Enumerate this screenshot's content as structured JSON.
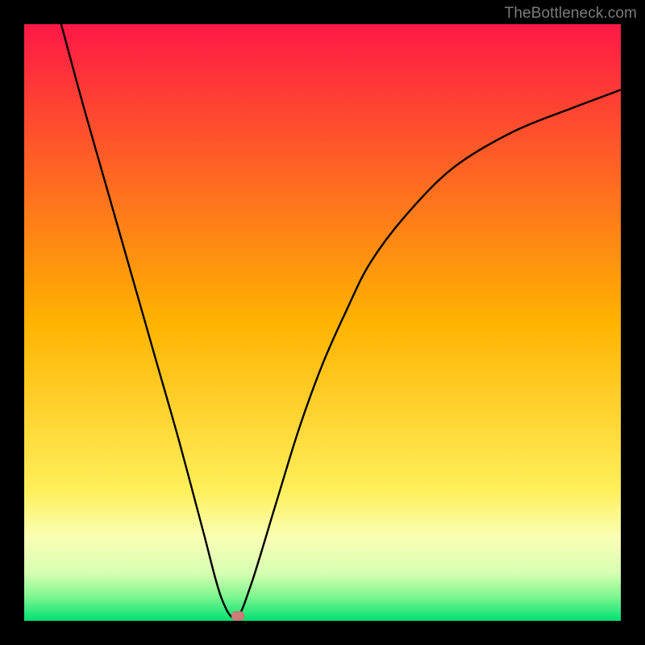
{
  "watermark": {
    "text": "TheBottleneck.com"
  },
  "chart_data": {
    "type": "line",
    "title": "",
    "xlabel": "",
    "ylabel": "",
    "xlim": [
      0,
      1
    ],
    "ylim": [
      0,
      1
    ],
    "gradient_stops": [
      {
        "offset": 0.0,
        "color": "#ff1846"
      },
      {
        "offset": 0.5,
        "color": "#ffb300"
      },
      {
        "offset": 0.78,
        "color": "#ffef5a"
      },
      {
        "offset": 0.86,
        "color": "#f9ffb4"
      },
      {
        "offset": 0.92,
        "color": "#d7ffb3"
      },
      {
        "offset": 0.96,
        "color": "#7cf58f"
      },
      {
        "offset": 1.0,
        "color": "#00e171"
      }
    ],
    "series": [
      {
        "name": "bottleneck-curve",
        "x": [
          0.062,
          0.1,
          0.14,
          0.18,
          0.22,
          0.26,
          0.3,
          0.33,
          0.355,
          0.38,
          0.42,
          0.46,
          0.5,
          0.54,
          0.58,
          0.64,
          0.72,
          0.82,
          0.92,
          1.0
        ],
        "values": [
          1.0,
          0.86,
          0.72,
          0.58,
          0.44,
          0.3,
          0.15,
          0.04,
          0.005,
          0.06,
          0.19,
          0.32,
          0.43,
          0.52,
          0.6,
          0.68,
          0.76,
          0.82,
          0.86,
          0.89
        ]
      }
    ],
    "marker": {
      "x": 0.358,
      "y": 0.008
    }
  }
}
